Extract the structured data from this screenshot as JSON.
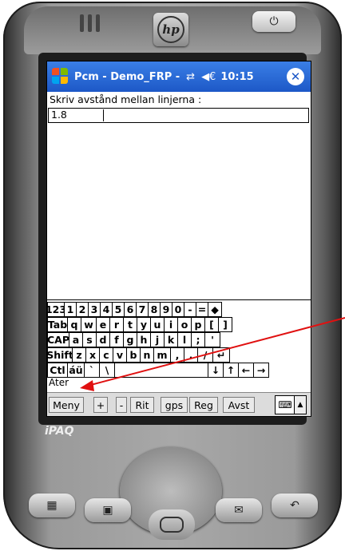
{
  "device": {
    "brand_logo": "hp",
    "model": "iPAQ",
    "power_symbol": "⏻"
  },
  "titlebar": {
    "title": "Pcm - Demo_FRP -",
    "sync_symbol": "⇄",
    "volume_symbol": "◀€",
    "time": "10:15",
    "close_symbol": "✕"
  },
  "form": {
    "prompt": "Skriv avstånd mellan linjerna :",
    "value": "1.8"
  },
  "keyboard": {
    "rows": [
      [
        "123",
        "1",
        "2",
        "3",
        "4",
        "5",
        "6",
        "7",
        "8",
        "9",
        "0",
        "-",
        "=",
        "◆"
      ],
      [
        "Tab",
        "q",
        "w",
        "e",
        "r",
        "t",
        "y",
        "u",
        "i",
        "o",
        "p",
        "[",
        "]"
      ],
      [
        "CAP",
        "a",
        "s",
        "d",
        "f",
        "g",
        "h",
        "j",
        "k",
        "l",
        ";",
        "'"
      ],
      [
        "Shift",
        "z",
        "x",
        "c",
        "v",
        "b",
        "n",
        "m",
        ",",
        ".",
        "/",
        "↵"
      ],
      [
        "Ctl",
        "áü",
        "`",
        "\\",
        "",
        "↓",
        "↑",
        "←",
        "→"
      ]
    ]
  },
  "back_label": "Ater",
  "menubar": {
    "items": [
      "Meny",
      "+",
      "-",
      "Rit",
      "gps",
      "Reg",
      "Avst"
    ],
    "keyboard_icon": "⌨",
    "arrow": "▲"
  },
  "hardware_buttons": {
    "calendar": "▦",
    "contacts": "▣",
    "mail": "✉",
    "reply": "↶"
  },
  "colors": {
    "titlebar": "#1d58c7",
    "annotation_arrow": "#e01010"
  }
}
